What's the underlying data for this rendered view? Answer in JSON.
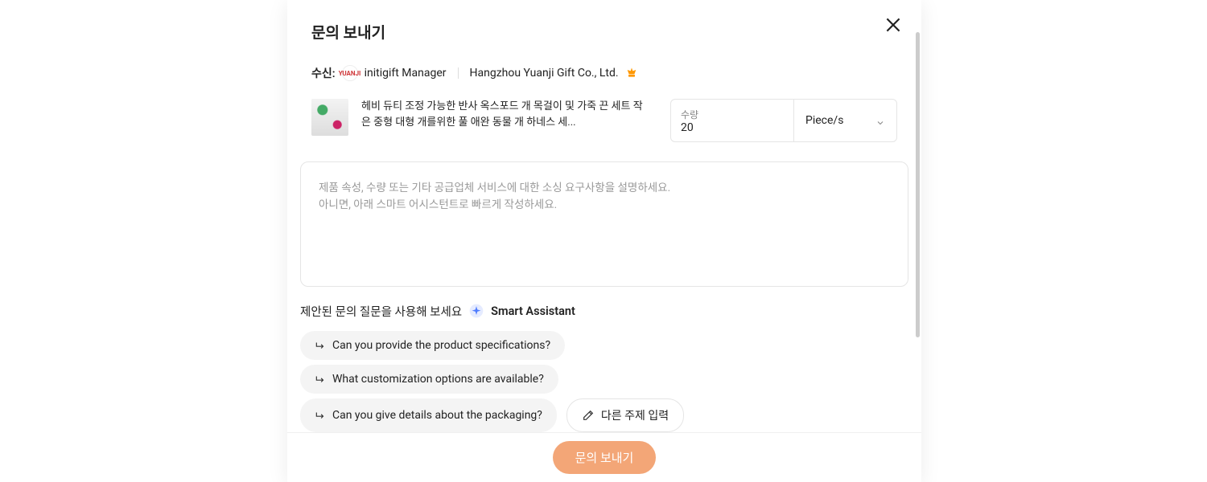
{
  "modal": {
    "title": "문의 보내기",
    "close_aria": "Close"
  },
  "recipient": {
    "label": "수신:",
    "avatar_text": "YUANJI",
    "name": "initigift Manager",
    "company": "Hangzhou Yuanji Gift Co., Ltd."
  },
  "product": {
    "name": "헤비 듀티 조정 가능한 반사 옥스포드 개 목걸이 및 가죽 끈 세트 작은 중형 대형 개를위한 풀 애완 동물 개 하네스 세..."
  },
  "quantity": {
    "label": "수량",
    "value": "20",
    "unit": "Piece/s"
  },
  "message": {
    "placeholder": "제품 속성, 수량 또는 기타 공급업체 서비스에 대한 소싱 요구사항을 설명하세요.\n아니면, 아래 스마트 어시스턴트로 빠르게 작성하세요."
  },
  "assistant": {
    "intro": "제안된 문의 질문을 사용해 보세요",
    "name": "Smart Assistant",
    "suggestions": [
      "Can you provide the product specifications?",
      "What customization options are available?",
      "Can you give details about the packaging?"
    ],
    "other_topic": "다른 주제 입력"
  },
  "footer": {
    "submit": "문의 보내기"
  }
}
